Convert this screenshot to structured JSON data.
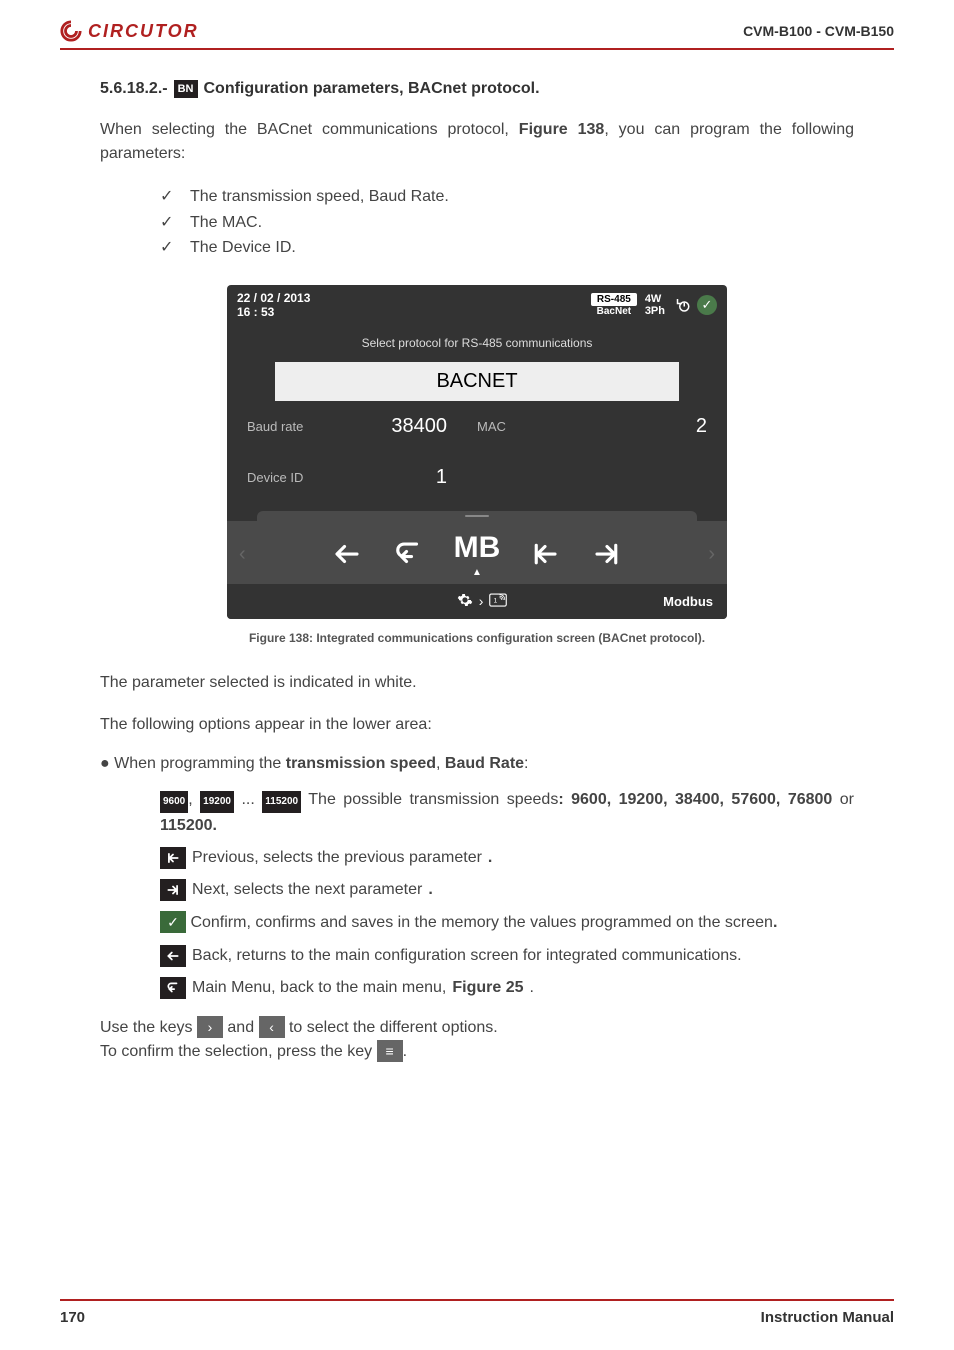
{
  "header": {
    "brand": "CIRCUTOR",
    "model": "CVM-B100 - CVM-B150"
  },
  "section": {
    "number": "5.6.18.2.-",
    "badge": "BN",
    "title_rest": " Configuration parameters, BACnet protocol."
  },
  "intro": {
    "pre": "When selecting the BACnet communications protocol, ",
    "figref": "Figure 138",
    "post": ", you can program the following parameters:"
  },
  "checks": [
    "The transmission speed, Baud Rate.",
    "The MAC.",
    "The Device ID."
  ],
  "device": {
    "date": "22 / 02 / 2013",
    "time": "16 : 53",
    "rs_top": "RS-485",
    "rs_bot": "BacNet",
    "wiring1": "4W",
    "wiring2": "3Ph",
    "msg": "Select protocol for RS-485 communications",
    "protocol": "BACNET",
    "baud_label": "Baud rate",
    "baud_value": "38400",
    "mac_label": "MAC",
    "mac_value": "2",
    "devid_label": "Device ID",
    "devid_value": "1",
    "nav_mb": "MB",
    "foot_right": "Modbus"
  },
  "caption": "Figure 138: Integrated communications configuration screen (BACnet protocol).",
  "para_selected": "The parameter selected is indicated in white.",
  "para_lower": "The following options appear in the lower area:",
  "bullet_line": {
    "pre": "When programming the ",
    "b1": "transmission speed",
    "mid": ", ",
    "b2": "Baud Rate",
    "post": ":"
  },
  "speeds": {
    "b9600": "9600",
    "b19200": "19200",
    "b115200": "115200",
    "text_pre": " The possible transmission speeds",
    "text_bold": ": 9600, 19200, 38400, 57600, 76800",
    "or": "or ",
    "last": "115200."
  },
  "opts": {
    "prev": " Previous, selects the previous parameter",
    "next": " Next, selects the next parameter",
    "confirm": " Confirm, confirms and saves in the memory the values programmed on the screen",
    "back": " Back, returns to the main configuration screen for integrated communications.",
    "menu_pre": " Main Menu, back to the main menu, ",
    "menu_fig": "Figure 25",
    "dot": "."
  },
  "keys": {
    "pre": "Use the keys ",
    "mid": " and ",
    "post": " to select the different options."
  },
  "confirm_line": {
    "pre": "To confirm the selection, press the key ",
    "post": "."
  },
  "footer": {
    "page": "170",
    "label": "Instruction Manual"
  }
}
